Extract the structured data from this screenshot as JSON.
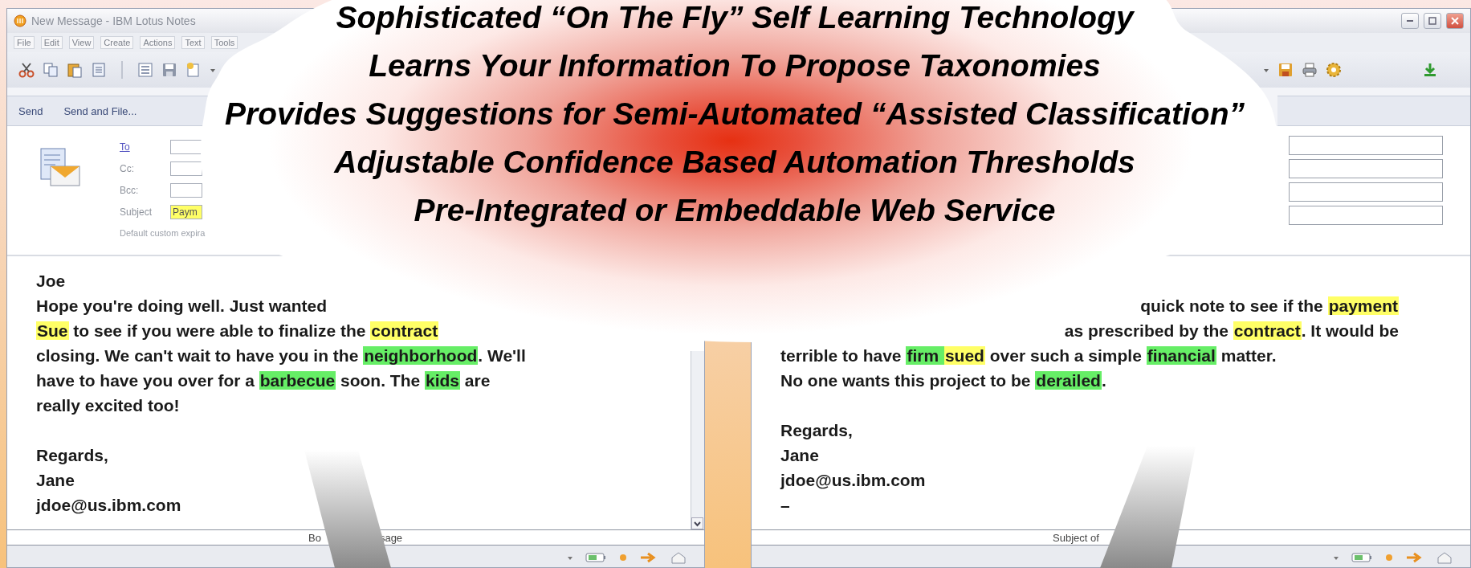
{
  "callout": {
    "lines": [
      "Sophisticated “On The Fly” Self Learning Technology",
      "Learns Your Information To Propose Taxonomies",
      "Provides Suggestions for Semi-Automated “Assisted Classification”",
      "Adjustable Confidence Based Automation Thresholds",
      "Pre-Integrated or Embeddable Web Service"
    ]
  },
  "left_window": {
    "title": "New Message - IBM Lotus Notes",
    "menu": [
      "File",
      "Edit",
      "View",
      "Create",
      "Actions",
      "Text",
      "Tools"
    ],
    "actions": [
      "Send",
      "Send and File..."
    ],
    "header": {
      "fields": [
        {
          "label": "To",
          "kind": "link"
        },
        {
          "label": "Cc:",
          "kind": "label"
        },
        {
          "label": "Bcc:",
          "kind": "label"
        },
        {
          "label": "Subject",
          "kind": "label",
          "value": "Paym",
          "color": "#ffff66"
        }
      ],
      "note": "Default custom expira"
    },
    "body": [
      {
        "lines": [
          {
            "covered": false,
            "segments": [
              {
                "text": "Joe"
              }
            ]
          },
          {
            "covered": false,
            "segments": [
              {
                "text": "Hope you're doing well. Just wanted"
              }
            ]
          },
          {
            "covered": false,
            "segments": [
              {
                "text": "Sue",
                "color": "#ffff66"
              },
              {
                "text": " to see if you were able to finalize the "
              },
              {
                "text": "contract",
                "color": "#ffff66"
              }
            ]
          },
          {
            "covered": false,
            "segments": [
              {
                "text": "closing. We can't wait to have you in the "
              },
              {
                "text": "neighborhood",
                "color": "#66ee66"
              },
              {
                "text": ". We'll"
              }
            ]
          },
          {
            "covered": false,
            "segments": [
              {
                "text": "have to have you over for a "
              },
              {
                "text": "barbecue",
                "color": "#66ee66"
              },
              {
                "text": " soon. The "
              },
              {
                "text": "kids",
                "color": "#66ee66"
              },
              {
                "text": " are"
              }
            ]
          },
          {
            "covered": false,
            "segments": [
              {
                "text": "really excited too!"
              }
            ]
          }
        ]
      },
      {
        "lines": [
          {
            "covered": false,
            "segments": [
              {
                "text": "Regards,"
              }
            ]
          },
          {
            "covered": false,
            "segments": [
              {
                "text": "Jane"
              }
            ]
          },
          {
            "covered": false,
            "segments": [
              {
                "text": "jdoe@us.ibm.com"
              }
            ]
          }
        ]
      }
    ],
    "field_label": [
      "Bo",
      "sage"
    ]
  },
  "right_window": {
    "body": [
      {
        "lines": [
          {
            "covered": true,
            "segments": [
              {
                "text": "quick note to see if the "
              },
              {
                "text": "payment",
                "color": "#ffff66"
              }
            ]
          },
          {
            "covered": true,
            "segments": [
              {
                "text": "as prescribed by the "
              },
              {
                "text": "contract",
                "color": "#ffff66"
              },
              {
                "text": ". It would be"
              }
            ]
          },
          {
            "covered": false,
            "segments": [
              {
                "text": "terrible to have "
              },
              {
                "text": "firm ",
                "color": "#66ee66"
              },
              {
                "text": "sued",
                "color": "#ffff66"
              },
              {
                "text": " over such a simple "
              },
              {
                "text": "financial",
                "color": "#66ee66"
              },
              {
                "text": " matter."
              }
            ]
          },
          {
            "covered": false,
            "segments": [
              {
                "text": "No one wants this project to be "
              },
              {
                "text": "derailed",
                "color": "#66ee66"
              },
              {
                "text": "."
              }
            ]
          }
        ]
      },
      {
        "lines": [
          {
            "covered": false,
            "segments": [
              {
                "text": "Regards,"
              }
            ]
          },
          {
            "covered": false,
            "segments": [
              {
                "text": "Jane"
              }
            ]
          },
          {
            "covered": false,
            "segments": [
              {
                "text": "jdoe@us.ibm.com"
              }
            ]
          },
          {
            "covered": false,
            "segments": [
              {
                "text": "–"
              }
            ]
          }
        ]
      }
    ],
    "field_label": [
      "Subject of"
    ]
  }
}
